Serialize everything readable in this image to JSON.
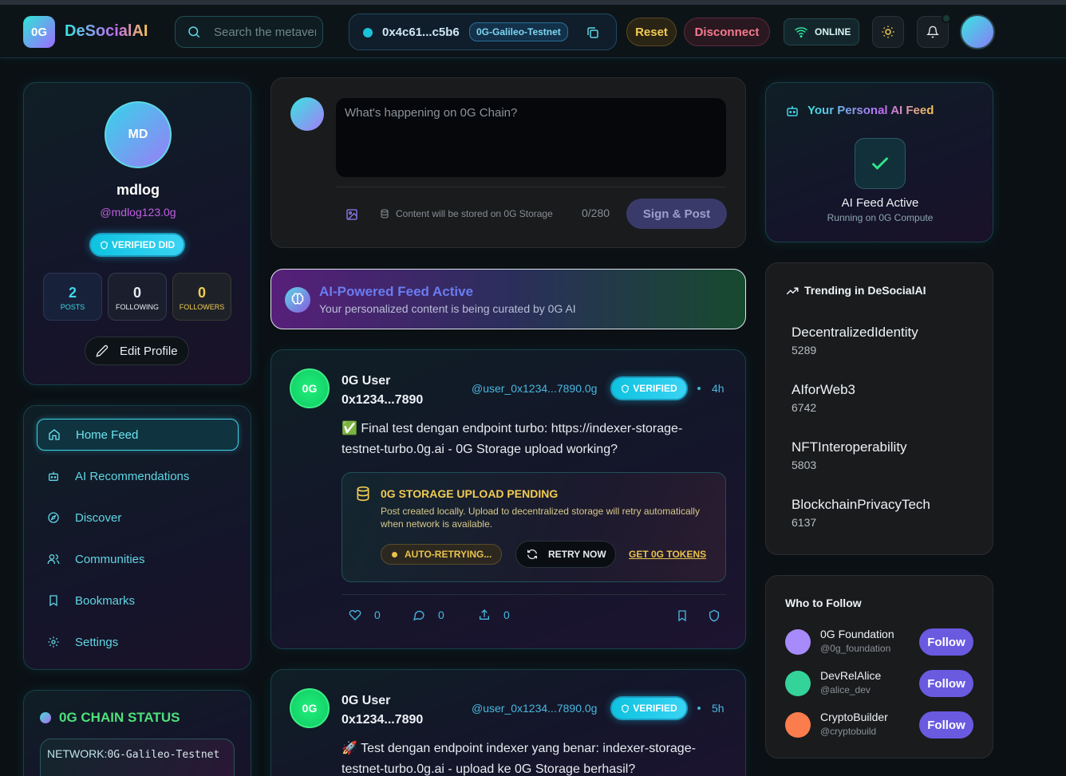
{
  "app": {
    "logo_badge": "0G",
    "name": "DeSocialAI"
  },
  "header": {
    "search_placeholder": "Search the metaverse...",
    "wallet_address": "0x4c61...c5b6",
    "network": "0G-Galileo-Testnet",
    "reset_label": "Reset",
    "disconnect_label": "Disconnect",
    "status_label": "ONLINE"
  },
  "profile": {
    "initials": "MD",
    "name": "mdlog",
    "handle": "@mdlog123.0g",
    "verified_label": "VERIFIED DID",
    "stats": {
      "posts": {
        "value": "2",
        "label": "POSTS"
      },
      "following": {
        "value": "0",
        "label": "FOLLOWING"
      },
      "followers": {
        "value": "0",
        "label": "FOLLOWERS"
      }
    },
    "edit_label": "Edit Profile"
  },
  "nav": {
    "items": [
      {
        "label": "Home Feed",
        "icon": "home-icon",
        "active": true
      },
      {
        "label": "AI Recommendations",
        "icon": "bot-icon"
      },
      {
        "label": "Discover",
        "icon": "compass-icon"
      },
      {
        "label": "Communities",
        "icon": "users-icon"
      },
      {
        "label": "Bookmarks",
        "icon": "bookmark-icon"
      },
      {
        "label": "Settings",
        "icon": "gear-icon"
      }
    ]
  },
  "chain_status": {
    "title": "0G CHAIN STATUS",
    "network_label": "NETWORK:",
    "network_value": "0G-Galileo-Testnet"
  },
  "composer": {
    "placeholder": "What's happening on 0G Chain?",
    "storage_note": "Content will be stored on 0G Storage",
    "counter": "0/280",
    "post_label": "Sign & Post"
  },
  "ai_banner": {
    "title": "AI-Powered Feed Active",
    "subtitle": "Your personalized content is being curated by 0G AI"
  },
  "posts": [
    {
      "avatar": "0G",
      "author": "0G User 0x1234...7890",
      "handle": "@user_0x1234...7890.0g",
      "verified_label": "VERIFIED",
      "time": "4h",
      "body": "✅ Final test dengan endpoint turbo: https://indexer-storage-testnet-turbo.0g.ai - 0G Storage upload working?",
      "storage": {
        "title": "0G STORAGE UPLOAD PENDING",
        "desc": "Post created locally. Upload to decentralized storage will retry automatically when network is available.",
        "auto_retry_label": "AUTO-RETRYING...",
        "retry_now_label": "RETRY NOW",
        "get_tokens_label": "GET 0G TOKENS"
      },
      "likes": "0",
      "comments": "0",
      "shares": "0"
    },
    {
      "avatar": "0G",
      "author": "0G User 0x1234...7890",
      "handle": "@user_0x1234...7890.0g",
      "verified_label": "VERIFIED",
      "time": "5h",
      "body": "🚀 Test dengan endpoint indexer yang benar: indexer-storage-testnet-turbo.0g.ai - upload ke 0G Storage berhasil?"
    }
  ],
  "ai_feed": {
    "title": "Your Personal AI Feed",
    "status": "AI Feed Active",
    "sub": "Running on 0G Compute"
  },
  "trending": {
    "title": "Trending in DeSocialAI",
    "items": [
      {
        "tag": "DecentralizedIdentity",
        "count": "5289"
      },
      {
        "tag": "AIforWeb3",
        "count": "6742"
      },
      {
        "tag": "NFTInteroperability",
        "count": "5803"
      },
      {
        "tag": "BlockchainPrivacyTech",
        "count": "6137"
      }
    ]
  },
  "who_to_follow": {
    "title": "Who to Follow",
    "follow_label": "Follow",
    "users": [
      {
        "name": "0G Foundation",
        "handle": "@0g_foundation",
        "color": "#a78bfa"
      },
      {
        "name": "DevRelAlice",
        "handle": "@alice_dev",
        "color": "#34d399"
      },
      {
        "name": "CryptoBuilder",
        "handle": "@cryptobuild",
        "color": "#fb7c4c"
      }
    ]
  },
  "colors": {
    "accent_cyan": "#3fd7e9",
    "accent_purple": "#6a5ae0",
    "warning_yellow": "#f2cc52",
    "danger_pink": "#f57a8e"
  }
}
